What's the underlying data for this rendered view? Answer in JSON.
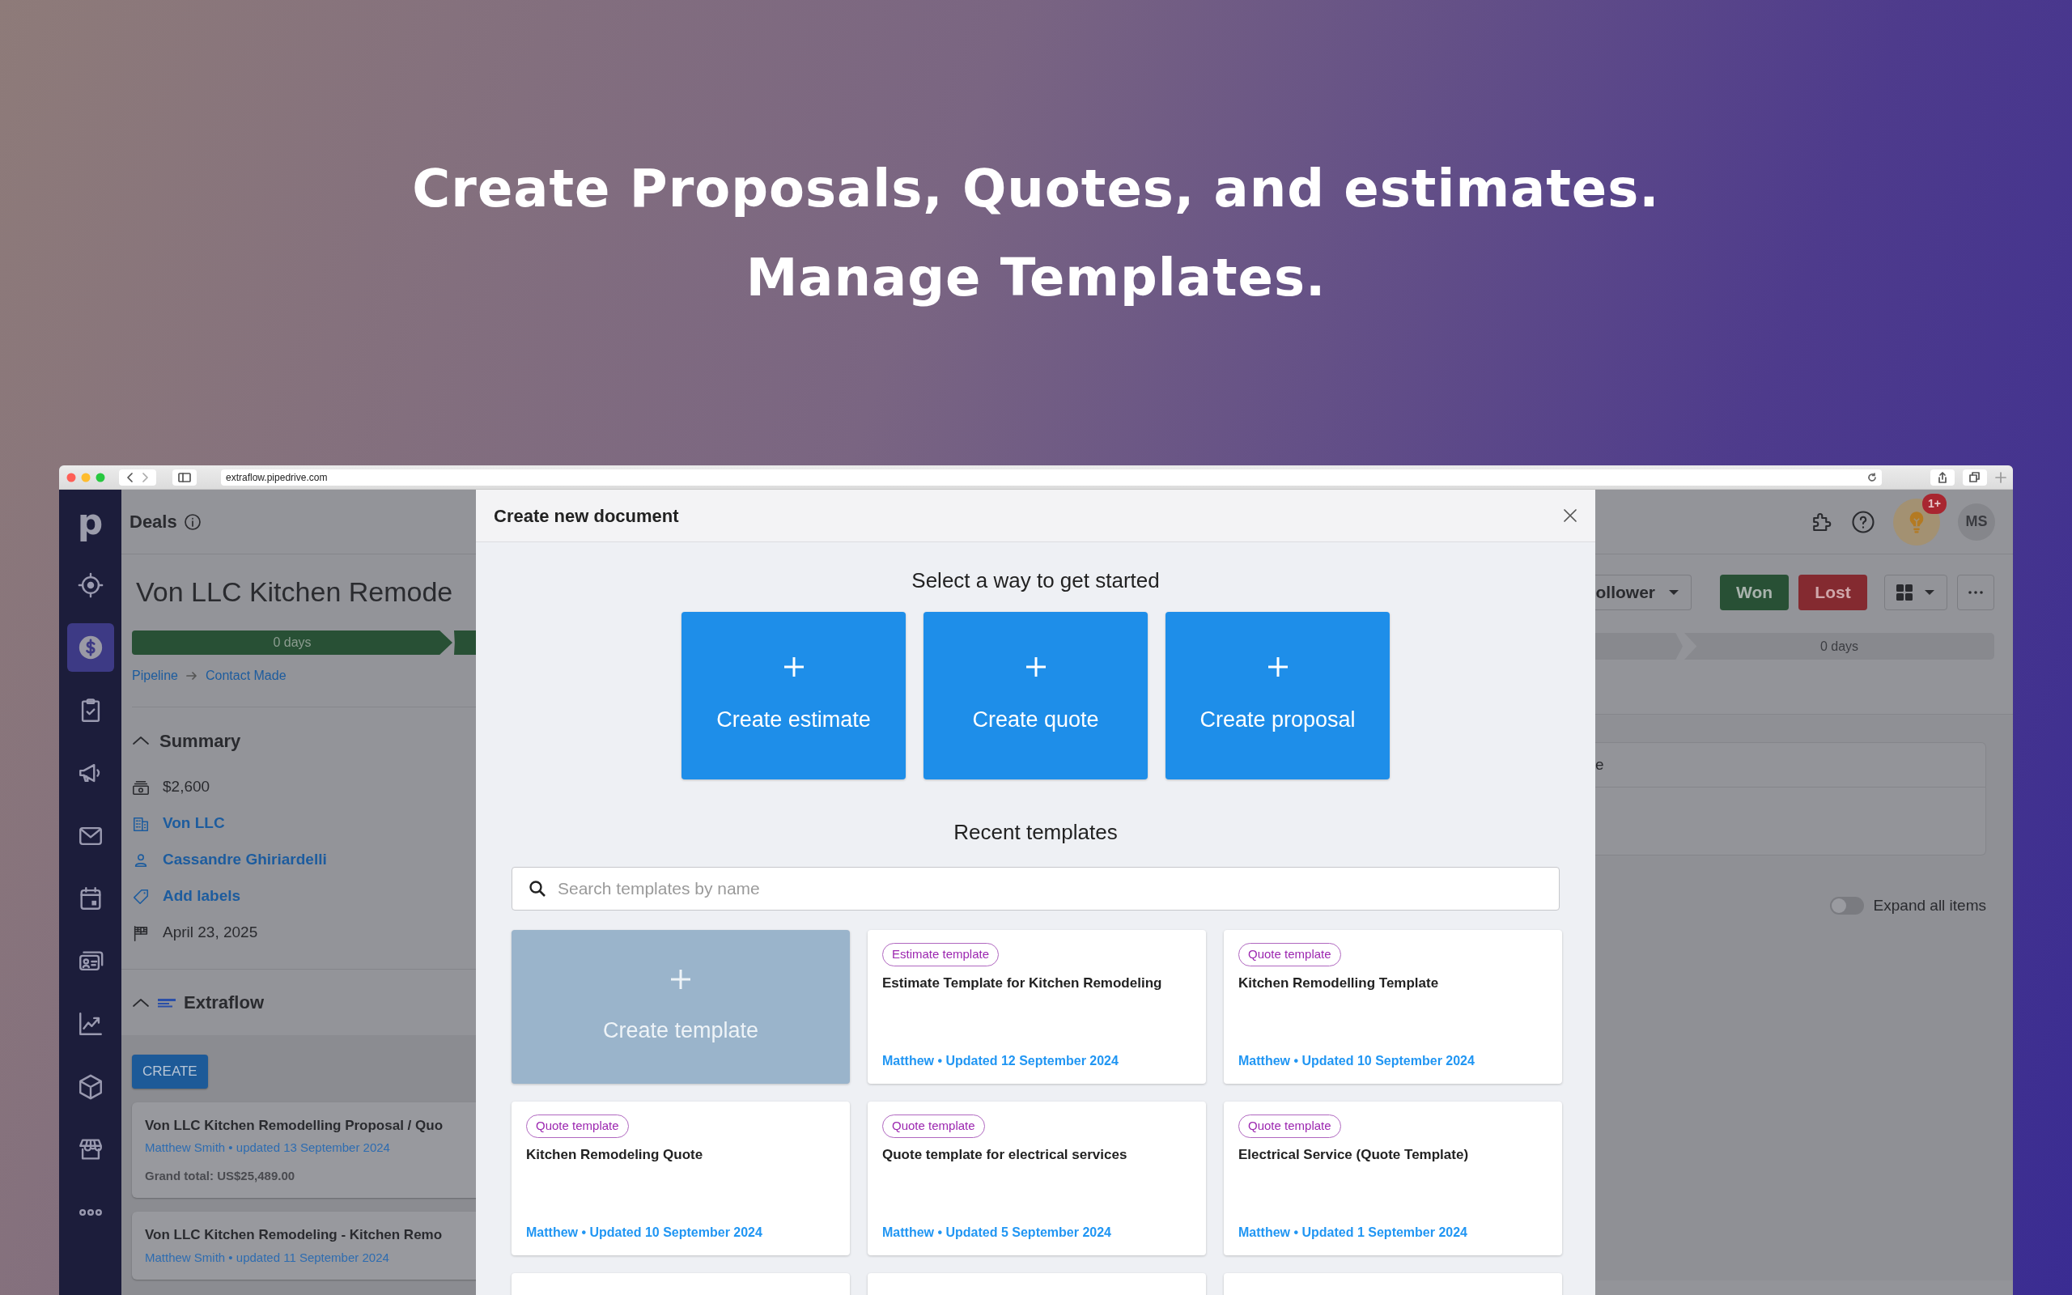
{
  "hero": {
    "lines": [
      "Create Proposals, Quotes, and estimates.",
      "Manage Templates."
    ]
  },
  "browser": {
    "url": "extraflow.pipedrive.com"
  },
  "sidebar": {
    "logo": "p",
    "items": [
      {
        "kind": "target",
        "selected": false
      },
      {
        "kind": "deals",
        "selected": true
      },
      {
        "kind": "tasks",
        "selected": false
      },
      {
        "kind": "campaigns",
        "selected": false
      },
      {
        "kind": "mail",
        "selected": false
      },
      {
        "kind": "calendar",
        "selected": false
      },
      {
        "kind": "contacts",
        "selected": false
      },
      {
        "kind": "insights",
        "selected": false
      },
      {
        "kind": "products",
        "selected": false
      },
      {
        "kind": "marketplace",
        "selected": false
      },
      {
        "kind": "more",
        "selected": false
      }
    ]
  },
  "header": {
    "title": "Deals"
  },
  "deal": {
    "title": "Von LLC Kitchen Remode",
    "stage_bar": "0 days",
    "pipeline": "Pipeline",
    "stage": "Contact Made"
  },
  "summary": {
    "title": "Summary",
    "expanded": true,
    "items": [
      {
        "kind": "value",
        "text": "$2,600",
        "link": false
      },
      {
        "kind": "organization",
        "text": "Von LLC",
        "link": true
      },
      {
        "kind": "person",
        "text": "Cassandre Ghiriardelli",
        "link": true
      },
      {
        "kind": "labels",
        "text": "Add labels",
        "link": true
      },
      {
        "kind": "date",
        "text": "April 23, 2025",
        "link": false
      }
    ]
  },
  "extraflow": {
    "title": "Extraflow",
    "expanded": true,
    "create_button": "CREATE",
    "documents": [
      {
        "title": "Von LLC Kitchen Remodelling Proposal / Quo",
        "meta": "Matthew Smith • updated 13 September 2024",
        "total": "Grand total: US$25,489.00"
      },
      {
        "title": "Von LLC Kitchen Remodeling - Kitchen Remo",
        "meta": "Matthew Smith • updated 11 September 2024"
      }
    ]
  },
  "topbar": {
    "notification_badge": "1+",
    "avatar": "MS"
  },
  "actions": {
    "follower_button": "ollower",
    "won": "Won",
    "lost": "Lost"
  },
  "right_stage_bar": "0 days",
  "right_panel": {
    "heading_fragment": "e"
  },
  "expand_all": {
    "label": "Expand all items",
    "on": false
  },
  "modal": {
    "title": "Create new document",
    "subtitle": "Select a way to get started",
    "create_options": [
      "Create estimate",
      "Create quote",
      "Create proposal"
    ],
    "recent_title": "Recent templates",
    "search": {
      "placeholder": "Search templates by name"
    },
    "create_template": "Create template",
    "templates": [
      {
        "kind": "template",
        "tag": "Estimate template",
        "title": "Estimate Template for Kitchen Remodeling",
        "meta": "Matthew • Updated 12 September 2024"
      },
      {
        "kind": "template",
        "tag": "Quote template",
        "title": "Kitchen Remodelling Template",
        "meta": "Matthew • Updated 10 September 2024"
      },
      {
        "kind": "template",
        "tag": "Quote template",
        "title": "Kitchen Remodeling Quote",
        "meta": "Matthew • Updated 10 September 2024"
      },
      {
        "kind": "template",
        "tag": "Quote template",
        "title": "Quote template for electrical services",
        "meta": "Matthew • Updated 5 September 2024"
      },
      {
        "kind": "template",
        "tag": "Quote template",
        "title": "Electrical Service (Quote Template)",
        "meta": "Matthew • Updated 1 September 2024"
      },
      {
        "kind": "cut"
      },
      {
        "kind": "cut"
      },
      {
        "kind": "cut"
      }
    ]
  }
}
